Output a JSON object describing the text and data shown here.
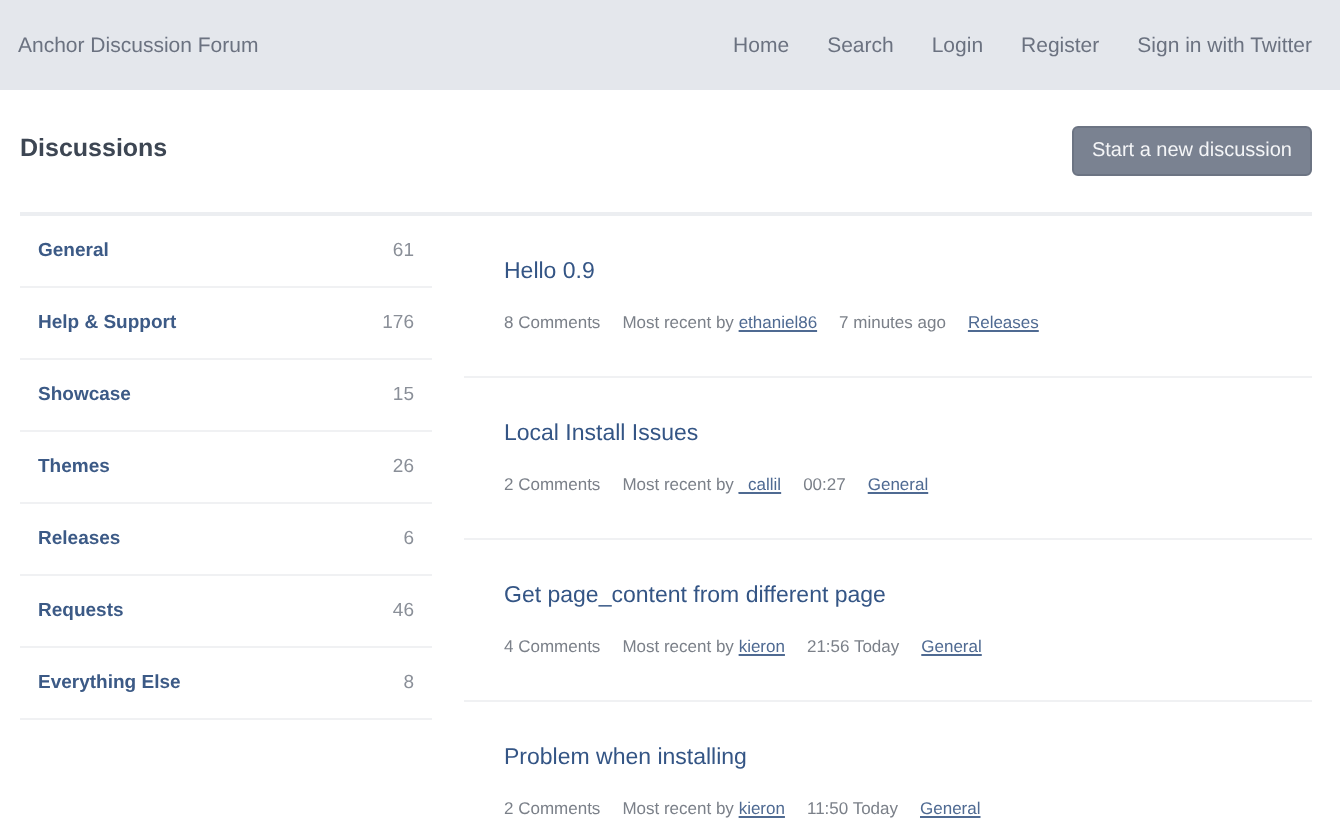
{
  "header": {
    "site_title": "Anchor Discussion Forum",
    "nav": [
      "Home",
      "Search",
      "Login",
      "Register",
      "Sign in with Twitter"
    ]
  },
  "page": {
    "title": "Discussions",
    "new_button": "Start a new discussion"
  },
  "categories": [
    {
      "name": "General",
      "count": "61"
    },
    {
      "name": "Help & Support",
      "count": "176"
    },
    {
      "name": "Showcase",
      "count": "15"
    },
    {
      "name": "Themes",
      "count": "26"
    },
    {
      "name": "Releases",
      "count": "6"
    },
    {
      "name": "Requests",
      "count": "46"
    },
    {
      "name": "Everything Else",
      "count": "8"
    }
  ],
  "discussions": [
    {
      "title": "Hello 0.9",
      "comments": "8 Comments",
      "recent_label": "Most recent by",
      "user": "ethaniel86",
      "time": "7 minutes ago",
      "category": "Releases"
    },
    {
      "title": "Local Install Issues",
      "comments": "2 Comments",
      "recent_label": "Most recent by",
      "user": "_callil",
      "time": "00:27",
      "category": "General"
    },
    {
      "title": "Get page_content from different page",
      "comments": "4 Comments",
      "recent_label": "Most recent by",
      "user": "kieron",
      "time": "21:56 Today",
      "category": "General"
    },
    {
      "title": "Problem when installing",
      "comments": "2 Comments",
      "recent_label": "Most recent by",
      "user": "kieron",
      "time": "11:50 Today",
      "category": "General"
    }
  ]
}
